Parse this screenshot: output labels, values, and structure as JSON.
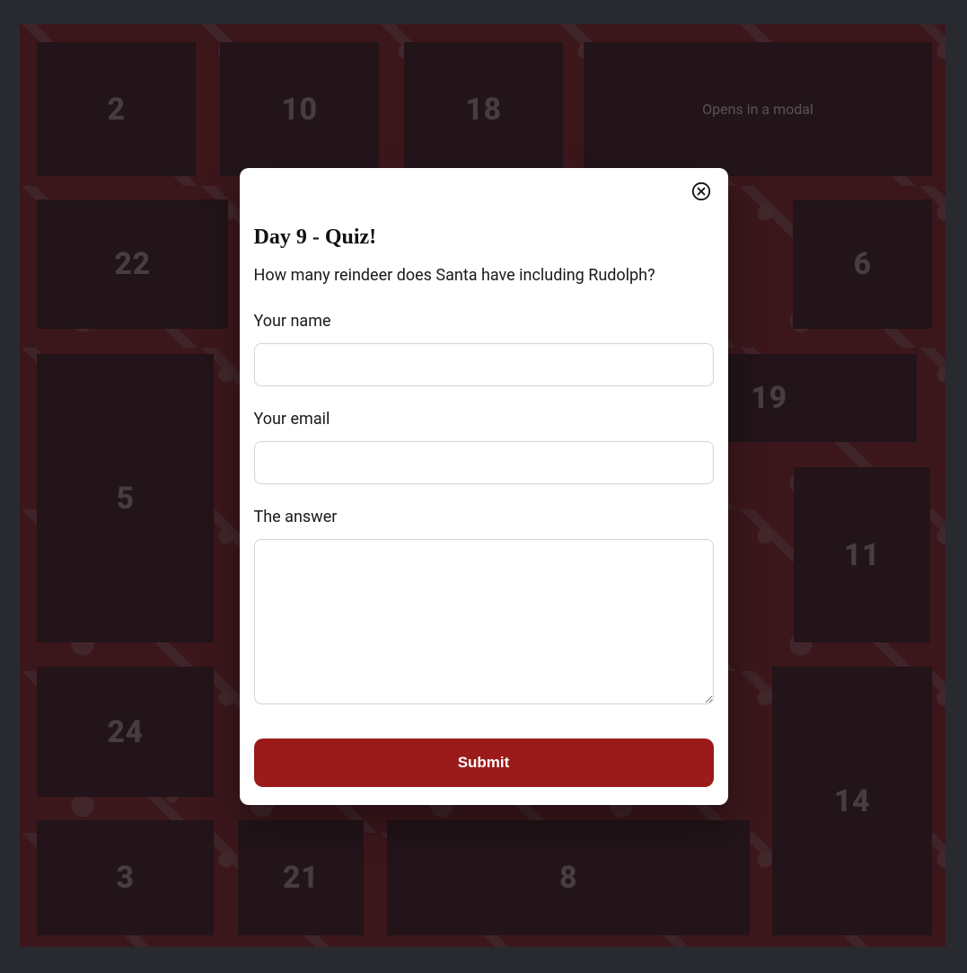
{
  "tiles": {
    "row1": {
      "t1": "2",
      "t2": "10",
      "t3": "18",
      "t4_text": "Opens in a modal"
    },
    "row2": {
      "t1": "22",
      "t4": "6"
    },
    "row3": {
      "t1": "5",
      "t3": "19",
      "t4": "11"
    },
    "row4": {
      "t1": "24",
      "t4": "14"
    },
    "row5": {
      "t1": "3",
      "t2": "21",
      "t3": "8"
    }
  },
  "modal": {
    "title": "Day 9 - Quiz!",
    "question": "How many reindeer does Santa have including Rudolph?",
    "labels": {
      "name": "Your name",
      "email": "Your email",
      "answer": "The answer"
    },
    "values": {
      "name": "",
      "email": "",
      "answer": ""
    },
    "submit_label": "Submit"
  },
  "colors": {
    "accent": "#9b1a1a"
  }
}
